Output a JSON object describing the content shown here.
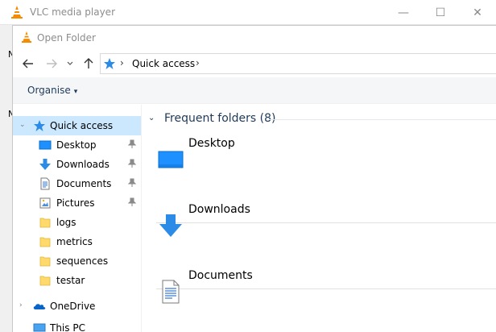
{
  "app": {
    "title": "VLC media player",
    "controls": {
      "minimize": "—",
      "maximize": "☐",
      "close": "✕"
    },
    "strip_marks": [
      "N",
      "N"
    ]
  },
  "dialog": {
    "title": "Open Folder",
    "nav": {
      "back_icon": "arrow-left-icon",
      "forward_icon": "arrow-right-icon",
      "recent_icon": "chevron-down-icon",
      "up_icon": "arrow-up-icon",
      "breadcrumb": "Quick access",
      "sep1": "›",
      "sep2": "›"
    },
    "toolbar": {
      "organise_label": "Organise",
      "caret": "▾"
    },
    "navpane": {
      "quick_access": "Quick access",
      "items": [
        {
          "label": "Desktop",
          "icon": "desktop-icon",
          "pinned": true
        },
        {
          "label": "Downloads",
          "icon": "download-icon",
          "pinned": true
        },
        {
          "label": "Documents",
          "icon": "documents-icon",
          "pinned": true
        },
        {
          "label": "Pictures",
          "icon": "pictures-icon",
          "pinned": true
        },
        {
          "label": "logs",
          "icon": "folder-icon",
          "pinned": false
        },
        {
          "label": "metrics",
          "icon": "folder-icon",
          "pinned": false
        },
        {
          "label": "sequences",
          "icon": "folder-icon",
          "pinned": false
        },
        {
          "label": "testar",
          "icon": "folder-icon",
          "pinned": false
        }
      ],
      "onedrive": "OneDrive",
      "thispc": "This PC"
    },
    "content": {
      "group_title": "Frequent folders (8)",
      "tiles": [
        {
          "name": "Desktop",
          "icon": "desktop-icon"
        },
        {
          "name": "Downloads",
          "icon": "download-icon"
        },
        {
          "name": "Documents",
          "icon": "documents-icon"
        }
      ]
    }
  },
  "colors": {
    "accent": "#1e395b",
    "selected": "#cce8ff",
    "folder": "#ffd96b",
    "blue_icon": "#2b8be6"
  }
}
